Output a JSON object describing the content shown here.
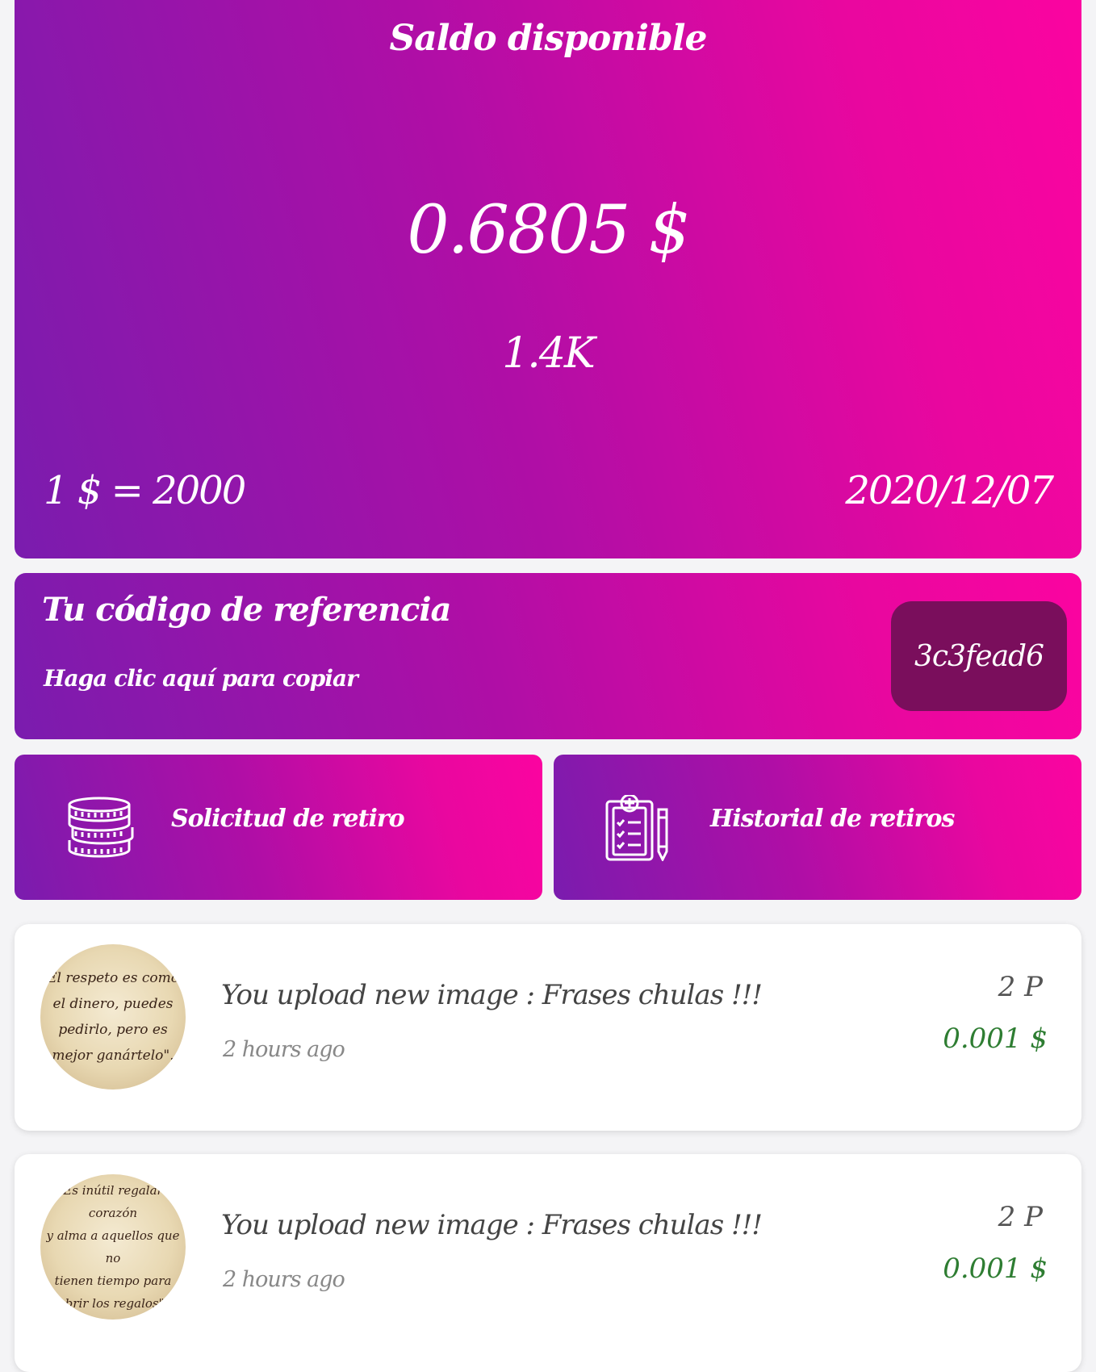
{
  "balance_card": {
    "title": "Saldo disponible",
    "balance": "0.6805 $",
    "points": "1.4K",
    "rate": "1 $ = 2000",
    "date": "2020/12/07"
  },
  "referral": {
    "title": "Tu código de referencia",
    "subtitle": "Haga clic aquí para copiar",
    "code": "3c3fead6"
  },
  "actions": [
    {
      "label": "Solicitud de retiro",
      "icon": "coins-icon"
    },
    {
      "label": "Historial de retiros",
      "icon": "clipboard-icon"
    }
  ],
  "activity": [
    {
      "title": "You upload new image : Frases chulas !!!",
      "time": "2 hours ago",
      "points": "2 P",
      "amount": "0.001 $",
      "thumb_lines": [
        "El respeto es como",
        "el dinero, puedes",
        "pedirlo, pero es",
        "mejor ganártelo\"."
      ]
    },
    {
      "title": "You upload new image : Frases chulas !!!",
      "time": "2 hours ago",
      "points": "2 P",
      "amount": "0.001 $",
      "thumb_lines": [
        "Es inútil regalar corazón",
        "y alma a aquellos que no",
        "tienen tiempo para",
        "abrir los regalos\"."
      ]
    }
  ],
  "colors": {
    "gradient_start": "#7a1cae",
    "gradient_end": "#fb04a0",
    "code_bg": "#7a0e5c",
    "amount_green": "#2e7d32"
  }
}
